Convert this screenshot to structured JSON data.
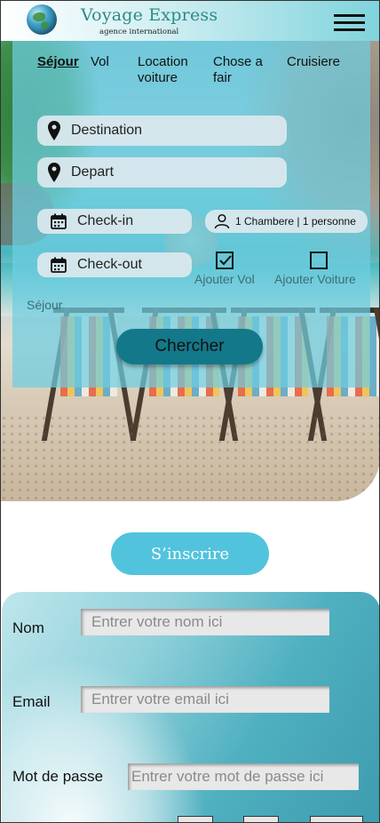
{
  "header": {
    "brand": "Voyage Express",
    "tagline": "agence international",
    "menu_icon": "hamburger-menu-icon"
  },
  "search": {
    "tabs": [
      {
        "label": "Séjour",
        "active": true
      },
      {
        "label": "Vol",
        "active": false
      },
      {
        "label": "Location voiture",
        "active": false
      },
      {
        "label": "Chose a fair",
        "active": false
      },
      {
        "label": "Cruisiere",
        "active": false
      }
    ],
    "destination_placeholder": "Destination",
    "depart_placeholder": "Depart",
    "checkin_placeholder": "Check-in",
    "checkout_placeholder": "Check-out",
    "guests": "1 Chambere | 1 personne",
    "add_flight": {
      "label": "Ajouter Vol",
      "checked": true
    },
    "add_car": {
      "label": "Ajouter Voiture",
      "checked": false
    },
    "mode_note": "Séjour",
    "submit": "Chercher"
  },
  "signup": {
    "button": "S’inscrire",
    "fields": [
      {
        "label": "Nom",
        "placeholder": "Entrer votre nom ici"
      },
      {
        "label": "Email",
        "placeholder": "Entrer votre email ici"
      },
      {
        "label": "Mot de passe",
        "placeholder": "Entrer votre mot de passe ici"
      }
    ]
  },
  "colors": {
    "brand_teal": "#2d8a86",
    "panel": "#6ecde0",
    "search_button": "#13788a",
    "signup_button": "#52c3dd"
  }
}
